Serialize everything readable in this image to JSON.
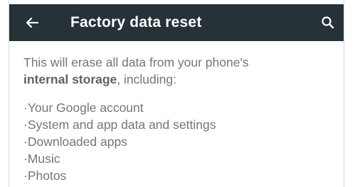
{
  "toolbar": {
    "title": "Factory data reset",
    "back_icon": "arrow-back-icon",
    "search_icon": "search-icon",
    "background": "#263238"
  },
  "intro": {
    "text_before": "This will erase all data from your phone's",
    "bold": "internal storage",
    "text_after": ", including:"
  },
  "items": [
    "·Your Google account",
    "·System and app data and settings",
    "·Downloaded apps",
    "·Music",
    "·Photos"
  ]
}
